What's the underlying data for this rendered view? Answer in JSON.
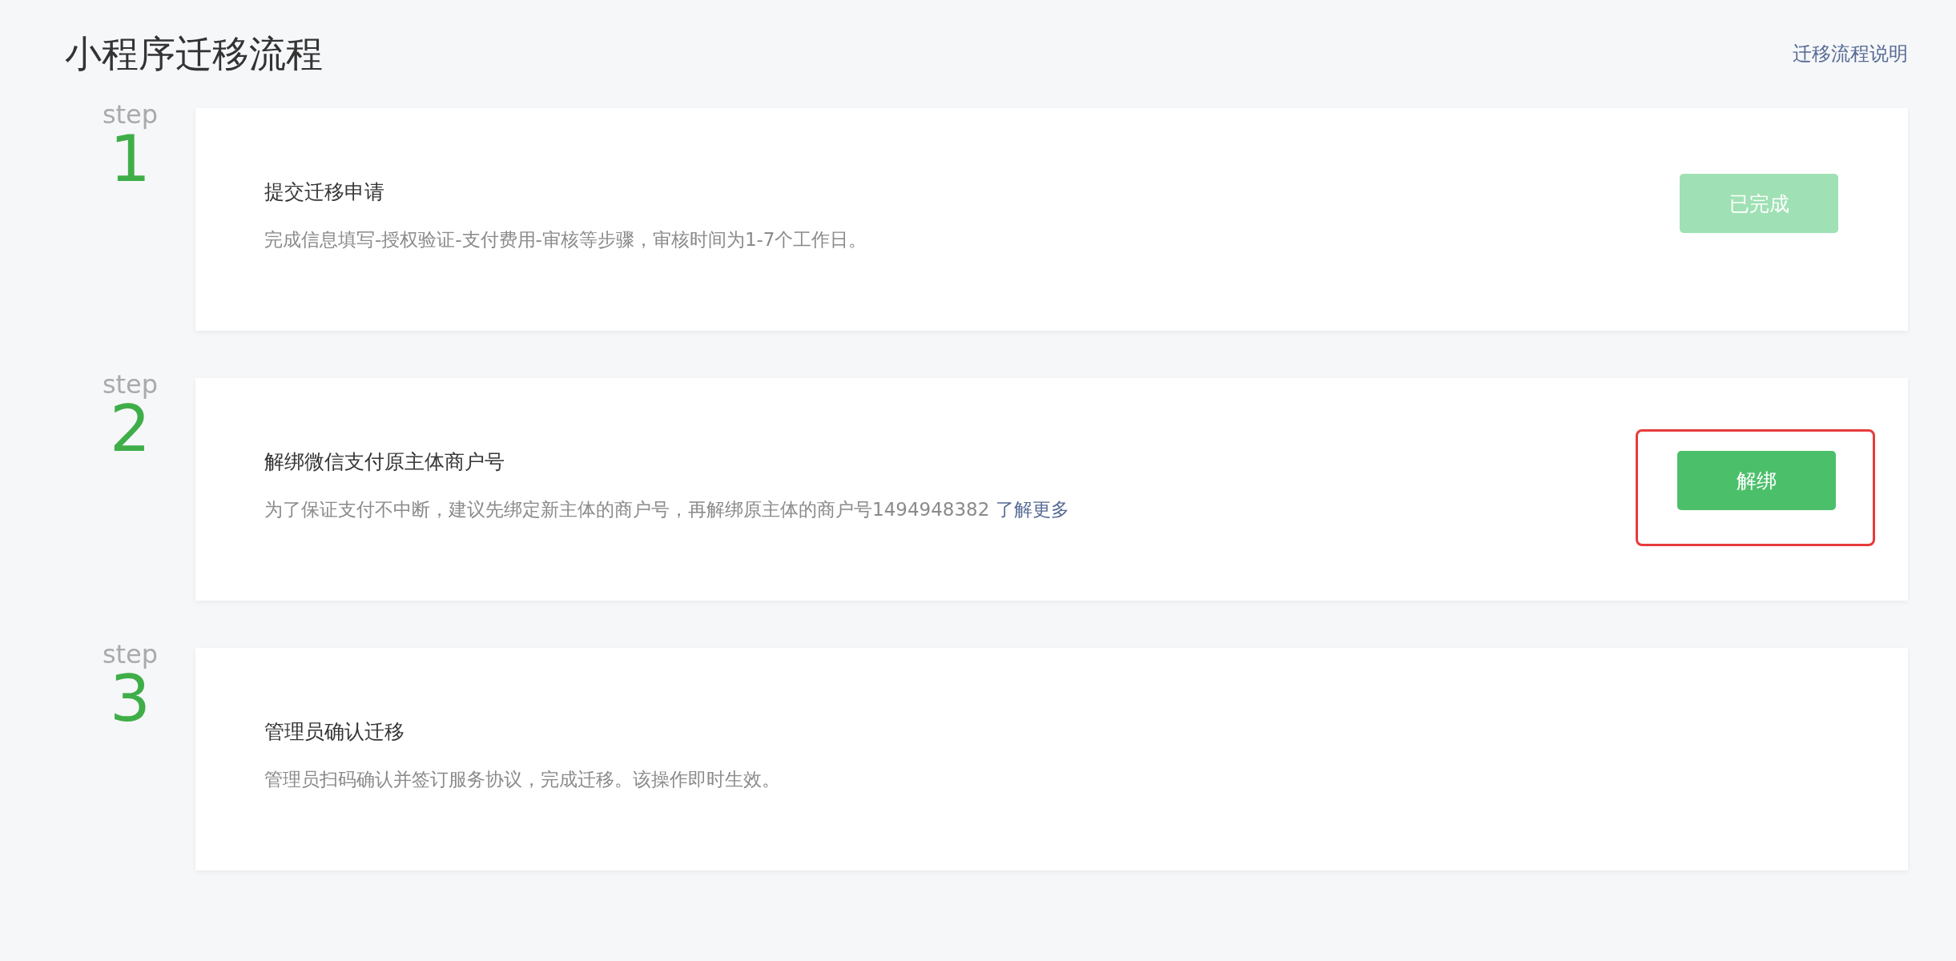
{
  "page": {
    "title": "小程序迁移流程",
    "help_link": "迁移流程说明"
  },
  "steps": [
    {
      "label": "step",
      "number": "1",
      "title": "提交迁移申请",
      "description": "完成信息填写-授权验证-支付费用-审核等步骤，审核时间为1-7个工作日。",
      "button": {
        "label": "已完成",
        "disabled": true,
        "highlighted": false
      }
    },
    {
      "label": "step",
      "number": "2",
      "title": "解绑微信支付原主体商户号",
      "description": "为了保证支付不中断，建议先绑定新主体的商户号，再解绑原主体的商户号1494948382",
      "link": "了解更多",
      "button": {
        "label": "解绑",
        "disabled": false,
        "highlighted": true
      }
    },
    {
      "label": "step",
      "number": "3",
      "title": "管理员确认迁移",
      "description": "管理员扫码确认并签订服务协议，完成迁移。该操作即时生效。"
    }
  ]
}
